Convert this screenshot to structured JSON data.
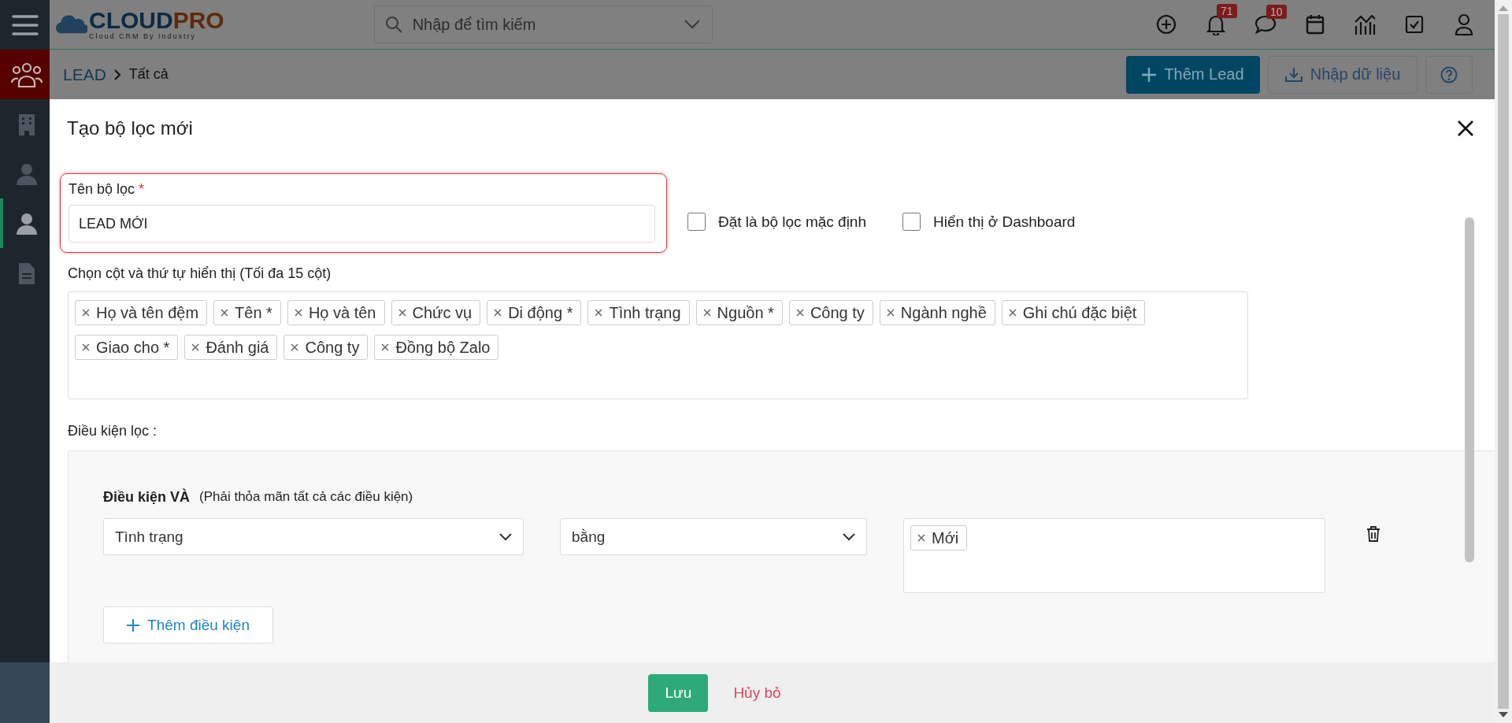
{
  "sidebar": {
    "items": [
      {
        "kind": "group",
        "selected": false,
        "highlighted": true
      },
      {
        "kind": "building",
        "selected": false,
        "highlighted": false
      },
      {
        "kind": "contact",
        "selected": false,
        "highlighted": false
      },
      {
        "kind": "person",
        "selected": true,
        "highlighted": false
      },
      {
        "kind": "document",
        "selected": false,
        "highlighted": false
      }
    ]
  },
  "header": {
    "logo": {
      "brand_a": "CLOUD",
      "brand_b": "PRO",
      "tagline": "Cloud CRM By Industry"
    },
    "search": {
      "placeholder": "Nhập để tìm kiếm"
    },
    "icons": [
      {
        "kind": "add"
      },
      {
        "kind": "bell",
        "badge": "71"
      },
      {
        "kind": "chat",
        "badge": "10"
      },
      {
        "kind": "calendar"
      },
      {
        "kind": "chart"
      },
      {
        "kind": "task"
      },
      {
        "kind": "user"
      }
    ]
  },
  "breadcrumb": [
    "LEAD",
    "Tất cả"
  ],
  "toolbar": {
    "add_button": "Thêm Lead",
    "import_button": "Nhập dữ liệu"
  },
  "modal": {
    "title": "Tạo bộ lọc mới",
    "name_field": {
      "label": "Tên bộ lọc",
      "required_mark": "*",
      "value": "LEAD MỚI"
    },
    "checkboxes": [
      {
        "label": "Đặt là bộ lọc mặc định",
        "checked": false
      },
      {
        "label": "Hiển thị ở Dashboard",
        "checked": false
      }
    ],
    "columns_label": "Chọn cột và thứ tự hiển thị (Tối đa 15 cột)",
    "columns": [
      "Họ và tên đệm",
      "Tên *",
      "Họ và tên",
      "Chức vụ",
      "Di động *",
      "Tình trạng",
      "Nguồn *",
      "Công ty",
      "Ngành nghề",
      "Ghi chú đặc biệt",
      "Giao cho *",
      "Đánh giá",
      "Công ty",
      "Đồng bộ Zalo"
    ],
    "conditions_label": "Điều kiện lọc :",
    "group": {
      "title": "Điều kiện VÀ",
      "hint": "(Phải thỏa mãn tất cả các điều kiện)",
      "rows": [
        {
          "field": "Tình trạng",
          "operator": "bằng",
          "values": [
            "Mới"
          ]
        }
      ],
      "add_button": "Thêm điều kiện"
    },
    "save_button": "Lưu",
    "cancel_button": "Hủy bỏ"
  }
}
